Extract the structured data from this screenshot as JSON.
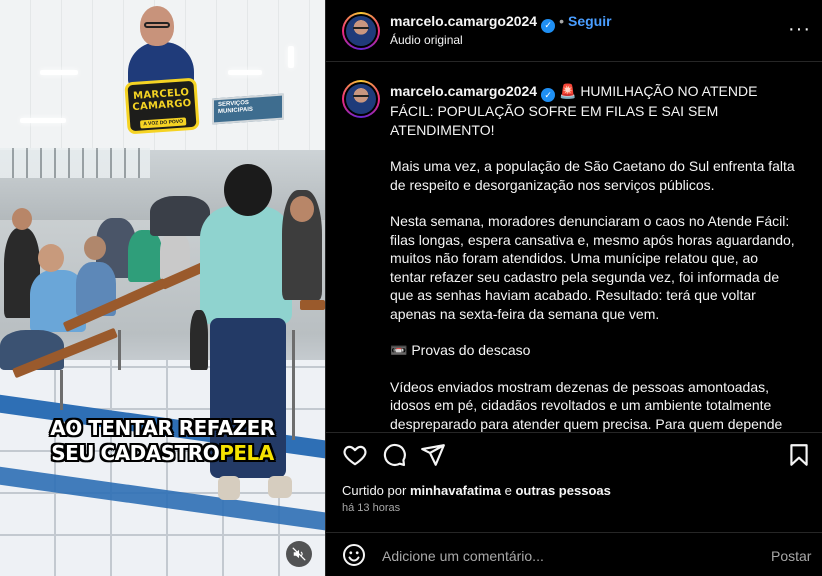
{
  "video": {
    "creator_name_line1": "MARCELO",
    "creator_name_line2": "CAMARGO",
    "creator_tag": "A VOZ DO POVO",
    "sign_text": "SERVIÇOS MUNICIPAIS",
    "caption_line1": "AO TENTAR REFAZER",
    "caption_line2_white": "SEU CADASTRO",
    "caption_line2_highlight": "PELA",
    "mute_icon": "speaker-muted-icon"
  },
  "header": {
    "username": "marcelo.camargo2024",
    "verified_icon": "verified-badge-icon",
    "separator": "•",
    "follow_label": "Seguir",
    "audio_label": "Áudio original",
    "more_icon": "more-options-icon",
    "more_glyph": "···"
  },
  "caption": {
    "username": "marcelo.camargo2024",
    "emoji_siren": "🚨",
    "title": "HUMILHAÇÃO NO ATENDE FÁCIL: POPULAÇÃO SOFRE EM FILAS E SAI SEM ATENDIMENTO!",
    "p1": "Mais uma vez, a população de São Caetano do Sul enfrenta falta de respeito e desorganização nos serviços públicos.",
    "p2": "Nesta semana, moradores denunciaram o caos no Atende Fácil: filas longas, espera cansativa e, mesmo após horas aguardando, muitos não foram atendidos. Uma munícipe relatou que, ao tentar refazer seu cadastro pela segunda vez, foi informada de que as senhas haviam acabado. Resultado: terá que voltar apenas na sexta-feira da semana que vem.",
    "p3_emoji": "📼",
    "p3": "Provas do descaso",
    "p4": "Vídeos enviados mostram dezenas de pessoas amontoadas, idosos em pé, cidadãos revoltados e um ambiente totalmente despreparado para atender quem precisa. Para quem depende do serviço, a sensação é de humilhação e abandono."
  },
  "actions": {
    "like_icon": "heart-icon",
    "comment_icon": "comment-icon",
    "share_icon": "send-icon",
    "save_icon": "bookmark-icon"
  },
  "likes": {
    "prefix": "Curtido por",
    "user": "minhavafatima",
    "conj": "e",
    "others": "outras pessoas"
  },
  "timestamp": "há 13 horas",
  "comment_bar": {
    "emoji_icon": "emoji-icon",
    "placeholder": "Adicione um comentário...",
    "post_label": "Postar"
  },
  "colors": {
    "accent_blue": "#4a9eff",
    "verified_blue": "#1f8ff3",
    "caption_highlight": "#f5e200",
    "badge_yellow": "#f5d323"
  }
}
